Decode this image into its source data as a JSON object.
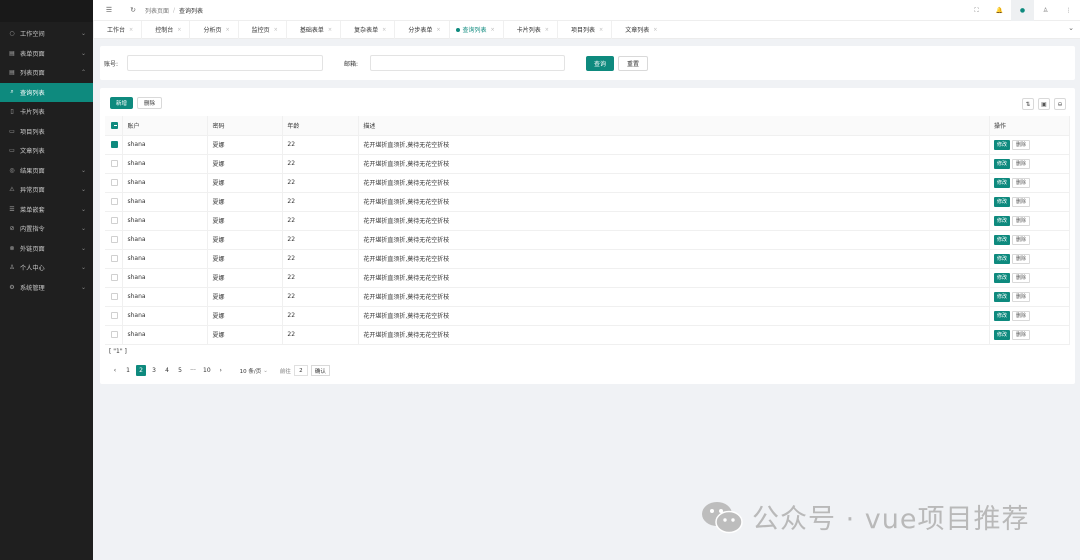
{
  "sidebar": {
    "items": [
      {
        "icon": "○",
        "label": "工作空间",
        "arrow": "⌄",
        "child": false,
        "active": false
      },
      {
        "icon": "▤",
        "label": "表单页面",
        "arrow": "⌄",
        "child": false,
        "active": false
      },
      {
        "icon": "▤",
        "label": "列表页面",
        "arrow": "⌃",
        "child": false,
        "active": false
      },
      {
        "icon": "⌕",
        "label": "查询列表",
        "arrow": "",
        "child": true,
        "active": true
      },
      {
        "icon": "▯",
        "label": "卡片列表",
        "arrow": "",
        "child": true,
        "active": false
      },
      {
        "icon": "▭",
        "label": "项目列表",
        "arrow": "",
        "child": true,
        "active": false
      },
      {
        "icon": "▭",
        "label": "文章列表",
        "arrow": "",
        "child": true,
        "active": false
      },
      {
        "icon": "◎",
        "label": "结果页面",
        "arrow": "⌄",
        "child": false,
        "active": false
      },
      {
        "icon": "⚠",
        "label": "异常页面",
        "arrow": "⌄",
        "child": false,
        "active": false
      },
      {
        "icon": "☰",
        "label": "菜单嵌套",
        "arrow": "⌄",
        "child": false,
        "active": false
      },
      {
        "icon": "⊘",
        "label": "内置指令",
        "arrow": "⌄",
        "child": false,
        "active": false
      },
      {
        "icon": "⊗",
        "label": "外链页面",
        "arrow": "⌄",
        "child": false,
        "active": false
      },
      {
        "icon": "♙",
        "label": "个人中心",
        "arrow": "⌄",
        "child": false,
        "active": false
      },
      {
        "icon": "⚙",
        "label": "系统管理",
        "arrow": "⌄",
        "child": false,
        "active": false
      }
    ]
  },
  "header": {
    "menu_icon": "☰",
    "refresh_icon": "↻",
    "breadcrumb": [
      "列表页面",
      "查询列表"
    ],
    "breadcrumb_sep": "/",
    "right_icons": [
      "⛶",
      "🔔",
      "●",
      "♙",
      "⋮"
    ]
  },
  "tabs": [
    {
      "label": "工作台",
      "active": false
    },
    {
      "label": "控制台",
      "active": false
    },
    {
      "label": "分析页",
      "active": false
    },
    {
      "label": "监控页",
      "active": false
    },
    {
      "label": "基础表单",
      "active": false
    },
    {
      "label": "复杂表单",
      "active": false
    },
    {
      "label": "分步表单",
      "active": false
    },
    {
      "label": "查询列表",
      "active": true
    },
    {
      "label": "卡片列表",
      "active": false
    },
    {
      "label": "项目列表",
      "active": false
    },
    {
      "label": "文章列表",
      "active": false
    }
  ],
  "search": {
    "account_label": "账号:",
    "account_placeholder": "",
    "email_label": "邮箱:",
    "email_placeholder": "",
    "query_button": "查询",
    "reset_button": "重置"
  },
  "toolbar": {
    "add_button": "新增",
    "delete_button": "删除"
  },
  "table": {
    "columns": [
      "账户",
      "密码",
      "年龄",
      "描述",
      "操作"
    ],
    "rows": [
      {
        "account": "shana",
        "password": "夏娜",
        "age": "22",
        "desc": "花开堪折直须折,莫待无花空折枝",
        "checked": true
      },
      {
        "account": "shana",
        "password": "夏娜",
        "age": "22",
        "desc": "花开堪折直须折,莫待无花空折枝",
        "checked": false
      },
      {
        "account": "shana",
        "password": "夏娜",
        "age": "22",
        "desc": "花开堪折直须折,莫待无花空折枝",
        "checked": false
      },
      {
        "account": "shana",
        "password": "夏娜",
        "age": "22",
        "desc": "花开堪折直须折,莫待无花空折枝",
        "checked": false
      },
      {
        "account": "shana",
        "password": "夏娜",
        "age": "22",
        "desc": "花开堪折直须折,莫待无花空折枝",
        "checked": false
      },
      {
        "account": "shana",
        "password": "夏娜",
        "age": "22",
        "desc": "花开堪折直须折,莫待无花空折枝",
        "checked": false
      },
      {
        "account": "shana",
        "password": "夏娜",
        "age": "22",
        "desc": "花开堪折直须折,莫待无花空折枝",
        "checked": false
      },
      {
        "account": "shana",
        "password": "夏娜",
        "age": "22",
        "desc": "花开堪折直须折,莫待无花空折枝",
        "checked": false
      },
      {
        "account": "shana",
        "password": "夏娜",
        "age": "22",
        "desc": "花开堪折直须折,莫待无花空折枝",
        "checked": false
      },
      {
        "account": "shana",
        "password": "夏娜",
        "age": "22",
        "desc": "花开堪折直须折,莫待无花空折枝",
        "checked": false
      },
      {
        "account": "shana",
        "password": "夏娜",
        "age": "22",
        "desc": "花开堪折直须折,莫待无花空折枝",
        "checked": false
      }
    ],
    "edit_label": "修改",
    "delete_label": "删除"
  },
  "selection_text": "[ \"1\" ]",
  "pagination": {
    "prev": "‹",
    "next": "›",
    "pages": [
      "1",
      "2",
      "3",
      "4",
      "5",
      "···",
      "10"
    ],
    "current": "2",
    "page_size": "10 条/页",
    "jump_label": "前往",
    "jump_value": "2",
    "confirm": "确认"
  },
  "watermark": "公众号 · vue项目推荐",
  "colors": {
    "primary": "#0e8a7e",
    "sidebar_bg": "#1f1f1f"
  }
}
